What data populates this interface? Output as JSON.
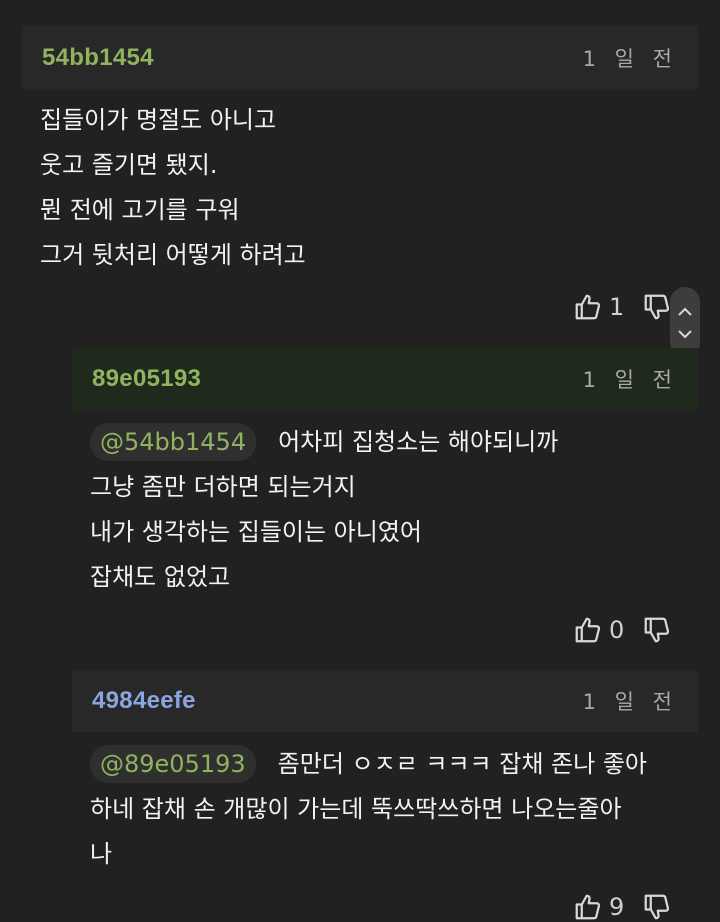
{
  "comments": [
    {
      "author": "54bb1454",
      "time": "1 일 전",
      "lines": [
        "집들이가 명절도 아니고",
        "웃고 즐기면 됐지.",
        "뭔 전에 고기를 구워",
        "그거 뒷처리 어떻게 하려고"
      ],
      "likes": "1",
      "author_color": "#8fb35f"
    },
    {
      "author": "89e05193",
      "time": "1 일 전",
      "mention": "@54bb1454",
      "lines": [
        "어차피 집청소는 해야되니까",
        "그냥 좀만 더하면 되는거지",
        "내가 생각하는 집들이는 아니였어",
        "잡채도 없었고"
      ],
      "likes": "0",
      "author_color": "#8fb35f"
    },
    {
      "author": "4984eefe",
      "time": "1 일 전",
      "mention": "@89e05193",
      "lines": [
        "좀만더 ㅇㅈㄹ ㅋㅋㅋ 잡채 존나 좋아",
        "하네 잡채 손 개많이 가는데 뚝쓰딱쓰하면 나오는줄아",
        "나"
      ],
      "likes": "9",
      "author_color": "#8aa5e0"
    }
  ],
  "icons": [
    "thumbs-up-icon",
    "thumbs-down-icon",
    "chevron-up-icon",
    "chevron-down-icon"
  ]
}
